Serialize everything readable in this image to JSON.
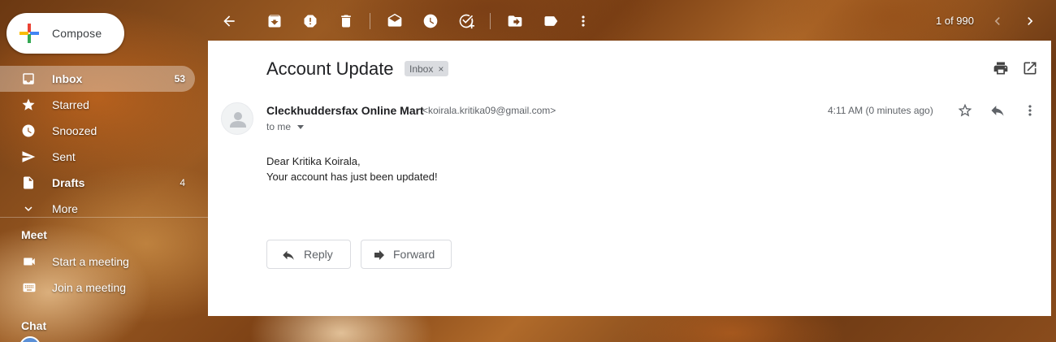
{
  "compose": {
    "label": "Compose"
  },
  "nav": [
    {
      "label": "Inbox",
      "count": "53",
      "icon": "inbox-icon"
    },
    {
      "label": "Starred",
      "count": "",
      "icon": "star-icon"
    },
    {
      "label": "Snoozed",
      "count": "",
      "icon": "clock-icon"
    },
    {
      "label": "Sent",
      "count": "",
      "icon": "send-icon"
    },
    {
      "label": "Drafts",
      "count": "4",
      "icon": "draft-icon"
    },
    {
      "label": "More",
      "count": "",
      "icon": "chevron-down-icon"
    }
  ],
  "meet": {
    "title": "Meet",
    "items": [
      {
        "label": "Start a meeting",
        "icon": "video-icon"
      },
      {
        "label": "Join a meeting",
        "icon": "keyboard-icon"
      }
    ]
  },
  "chat": {
    "title": "Chat"
  },
  "toolbar": {
    "pager": "1 of 990"
  },
  "email": {
    "subject": "Account Update",
    "label": "Inbox",
    "label_close": "×",
    "sender_name": "Cleckhuddersfax Online Mart",
    "sender_email": "<koirala.kritika09@gmail.com>",
    "to": "to me",
    "time": "4:11 AM (0 minutes ago)",
    "body": [
      "Dear Kritika Koirala,",
      "Your account has just been updated!"
    ],
    "reply_label": "Reply",
    "forward_label": "Forward"
  },
  "colors": {
    "white": "#ffffff",
    "text_primary": "#202124",
    "text_secondary": "#5f6368",
    "chip_bg": "#dadce0"
  }
}
